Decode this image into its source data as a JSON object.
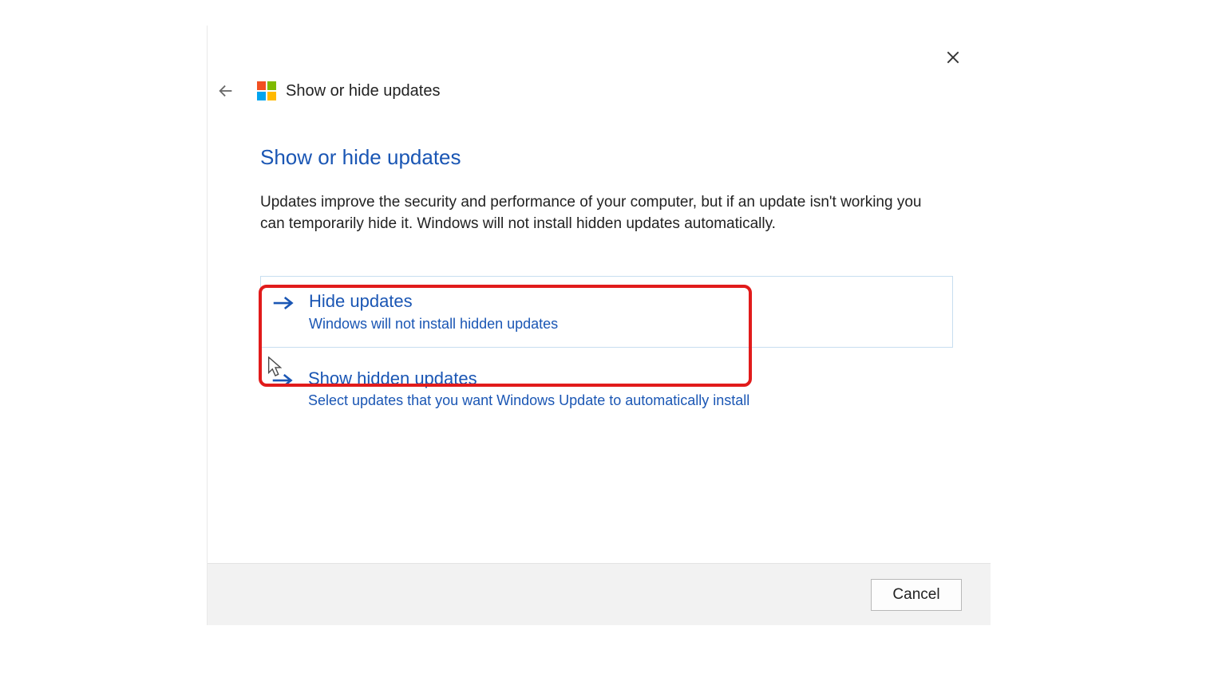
{
  "header": {
    "title": "Show or hide updates"
  },
  "main": {
    "heading": "Show or hide updates",
    "description": "Updates improve the security and performance of your computer, but if an update isn't working you can temporarily hide it. Windows will not install hidden updates automatically."
  },
  "options": [
    {
      "title": "Hide updates",
      "subtitle": "Windows will not install hidden updates"
    },
    {
      "title": "Show hidden updates",
      "subtitle": "Select updates that you want Windows Update to automatically install"
    }
  ],
  "footer": {
    "cancel_label": "Cancel"
  }
}
